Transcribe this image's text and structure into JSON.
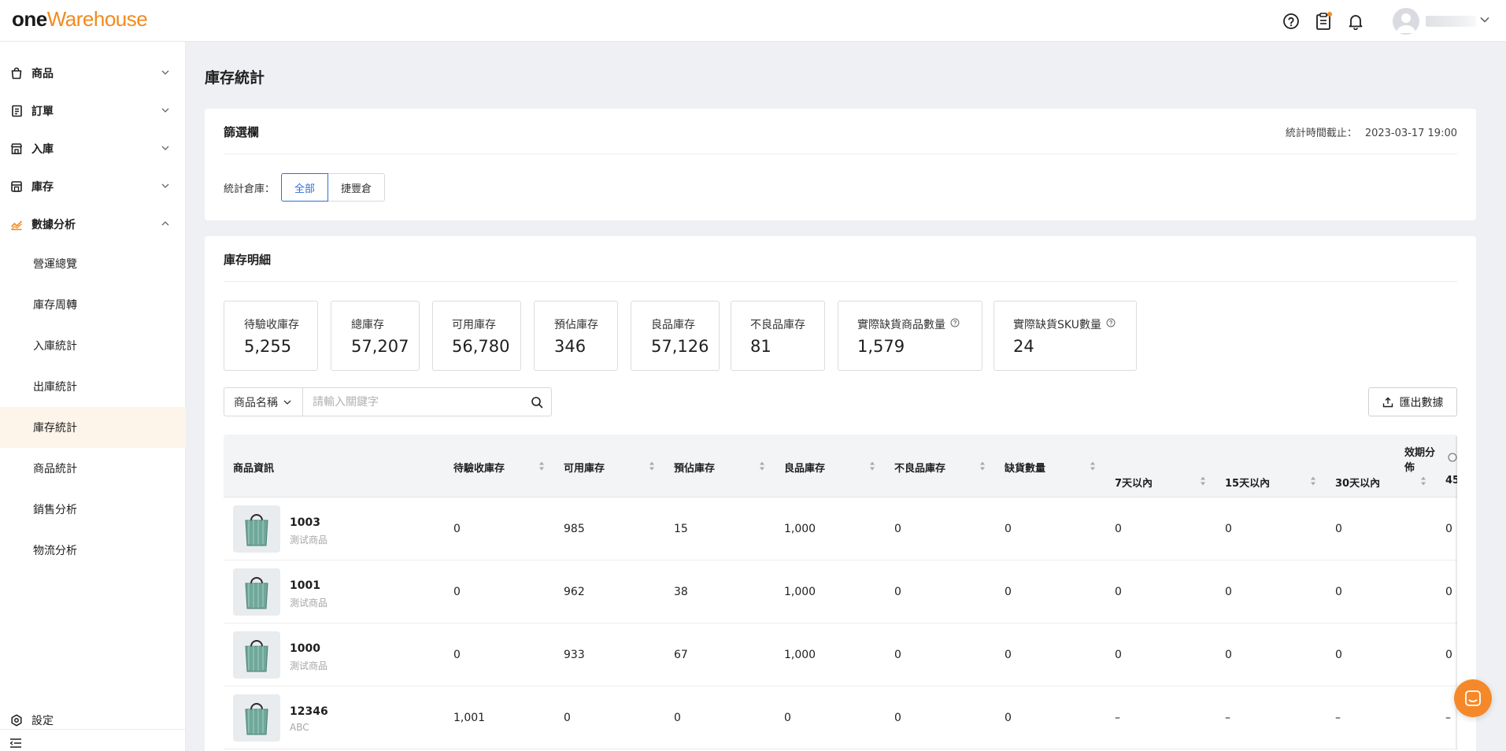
{
  "header": {
    "logo_one": "one",
    "logo_warehouse": "Warehouse",
    "icons": [
      "help-circle-icon",
      "clipboard-icon",
      "bell-icon",
      "avatar-icon",
      "chevron-down-icon"
    ],
    "accent_color": "#f28a1e"
  },
  "sidebar": {
    "groups": [
      {
        "label": "商品",
        "icon": "bag-icon"
      },
      {
        "label": "訂單",
        "icon": "order-list-icon"
      },
      {
        "label": "入庫",
        "icon": "inbound-icon"
      },
      {
        "label": "庫存",
        "icon": "warehouse-icon"
      },
      {
        "label": "數據分析",
        "icon": "analytics-icon"
      }
    ],
    "sub_items": [
      {
        "label": "營運總覽"
      },
      {
        "label": "庫存周轉"
      },
      {
        "label": "入庫統計"
      },
      {
        "label": "出庫統計"
      },
      {
        "label": "庫存統計",
        "active": true
      },
      {
        "label": "商品統計"
      },
      {
        "label": "銷售分析"
      },
      {
        "label": "物流分析"
      }
    ],
    "settings_label": "設定"
  },
  "page": {
    "title": "庫存統計"
  },
  "filter": {
    "title": "篩選欄",
    "stat_time_label": "統計時間截止：",
    "stat_time_value": "2023-03-17 19:00",
    "warehouse_label": "統計倉庫：",
    "options": [
      "全部",
      "捷豐倉"
    ],
    "selected": "全部"
  },
  "detail": {
    "title": "庫存明細",
    "kpis": [
      {
        "label": "待驗收庫存",
        "value": "5,255"
      },
      {
        "label": "總庫存",
        "value": "57,207"
      },
      {
        "label": "可用庫存",
        "value": "56,780"
      },
      {
        "label": "預佔庫存",
        "value": "346"
      },
      {
        "label": "良品庫存",
        "value": "57,126"
      },
      {
        "label": "不良品庫存",
        "value": "81"
      },
      {
        "label": "實際缺貨商品數量",
        "value": "1,579",
        "info": true
      },
      {
        "label": "實際缺貨SKU數量",
        "value": "24",
        "info": true
      }
    ],
    "search": {
      "field": "商品名稱",
      "placeholder": "請輸入關鍵字"
    },
    "export_label": "匯出數據"
  },
  "table": {
    "headers": {
      "product": "商品資訊",
      "pending": "待驗收庫存",
      "available": "可用庫存",
      "reserved": "預佔庫存",
      "good": "良品庫存",
      "bad": "不良品庫存",
      "shortage": "缺貨數量",
      "expiry_group": "效期分佈",
      "d7": "7天以內",
      "d15": "15天以內",
      "d30": "30天以內",
      "d45": "45"
    },
    "rows": [
      {
        "id": "1003",
        "name": "測试商品",
        "pending": "0",
        "available": "985",
        "reserved": "15",
        "good": "1,000",
        "bad": "0",
        "shortage": "0",
        "d7": "0",
        "d15": "0",
        "d30": "0",
        "d45": "0"
      },
      {
        "id": "1001",
        "name": "測试商品",
        "pending": "0",
        "available": "962",
        "reserved": "38",
        "good": "1,000",
        "bad": "0",
        "shortage": "0",
        "d7": "0",
        "d15": "0",
        "d30": "0",
        "d45": "0"
      },
      {
        "id": "1000",
        "name": "測试商品",
        "pending": "0",
        "available": "933",
        "reserved": "67",
        "good": "1,000",
        "bad": "0",
        "shortage": "0",
        "d7": "0",
        "d15": "0",
        "d30": "0",
        "d45": "0"
      },
      {
        "id": "12346",
        "name": "ABC",
        "pending": "1,001",
        "available": "0",
        "reserved": "0",
        "good": "0",
        "bad": "0",
        "shortage": "0",
        "d7": "–",
        "d15": "–",
        "d30": "–",
        "d45": "–"
      }
    ]
  }
}
